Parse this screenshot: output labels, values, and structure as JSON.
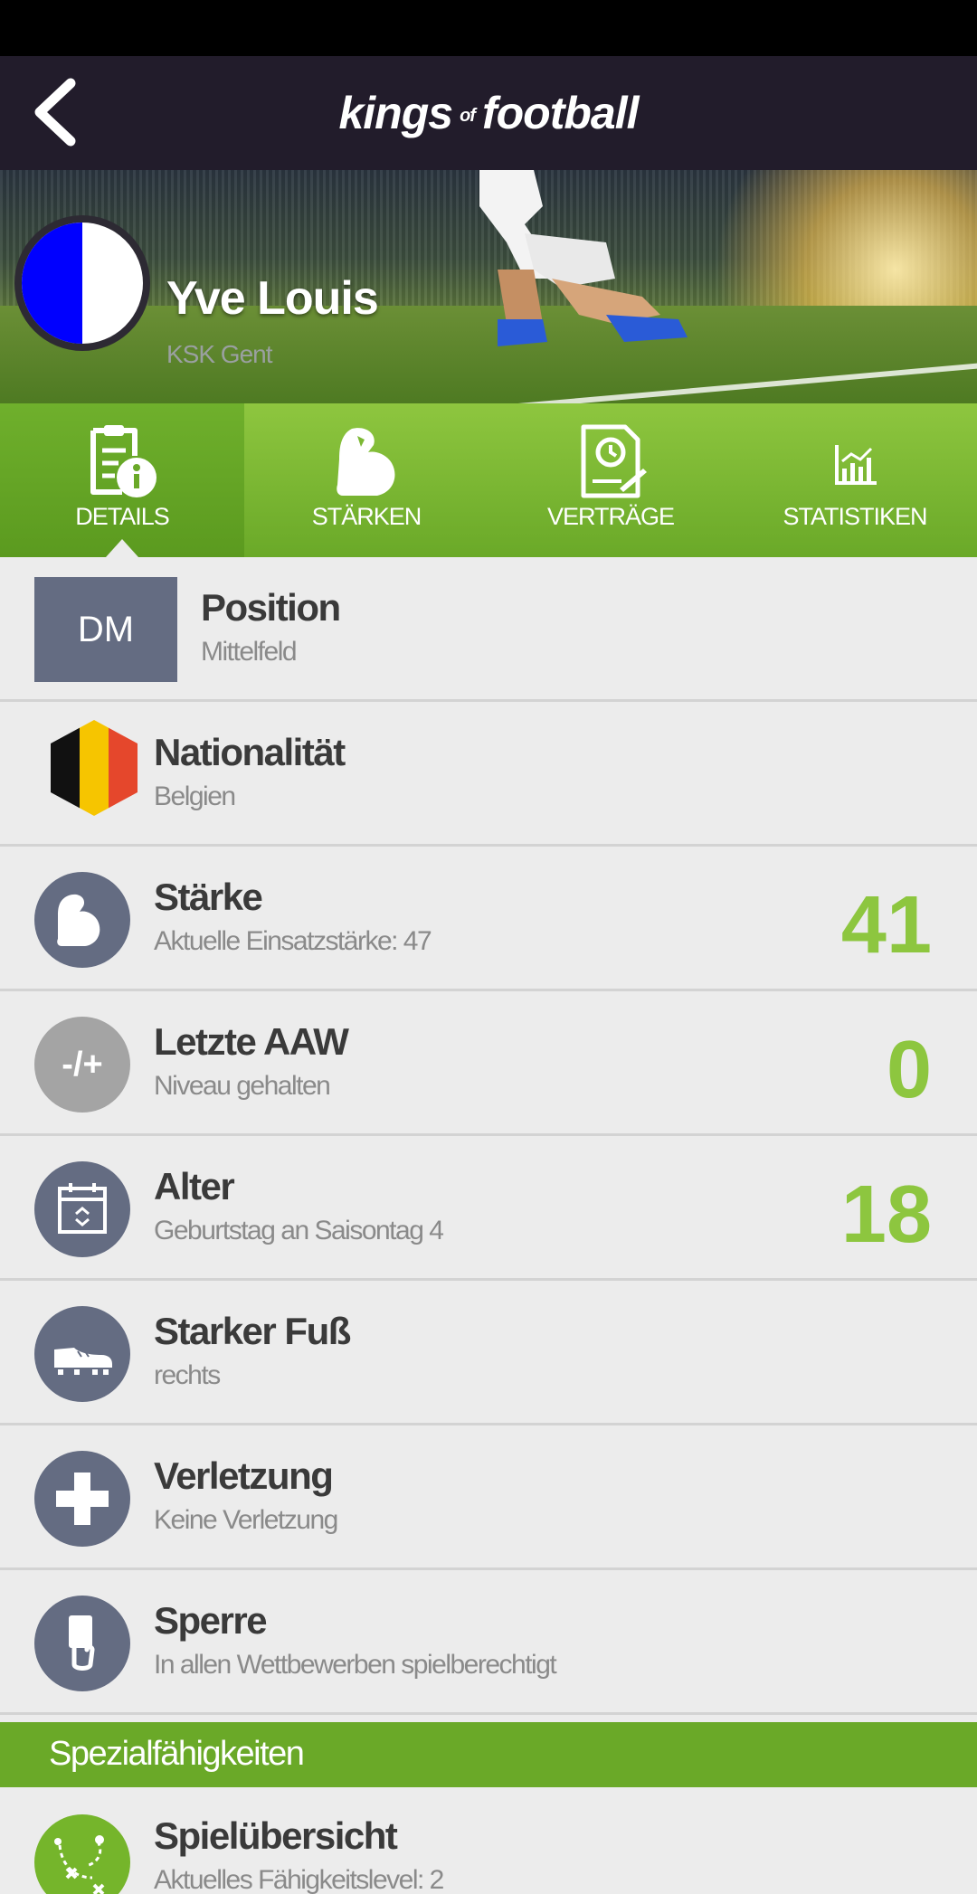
{
  "header": {
    "logo_kings": "kings",
    "logo_of": "of",
    "logo_football": "football"
  },
  "player": {
    "name": "Yve Louis",
    "club": "KSK Gent"
  },
  "tabs": [
    {
      "label": "DETAILS",
      "icon": "details-icon",
      "active": true
    },
    {
      "label": "STÄRKEN",
      "icon": "muscle-icon",
      "active": false
    },
    {
      "label": "VERTRÄGE",
      "icon": "contract-icon",
      "active": false
    },
    {
      "label": "STATISTIKEN",
      "icon": "stats-icon",
      "active": false
    }
  ],
  "rows": {
    "position": {
      "badge": "DM",
      "title": "Position",
      "sub": "Mittelfeld"
    },
    "nationality": {
      "title": "Nationalität",
      "sub": "Belgien"
    },
    "strength": {
      "title": "Stärke",
      "sub": "Aktuelle Einsatzstärke: 47",
      "value": "41"
    },
    "last_aaw": {
      "icon_text": "-/+",
      "title": "Letzte AAW",
      "sub": "Niveau gehalten",
      "value": "0"
    },
    "age": {
      "title": "Alter",
      "sub": "Geburtstag an Saisontag 4",
      "value": "18"
    },
    "foot": {
      "title": "Starker Fuß",
      "sub": "rechts"
    },
    "injury": {
      "title": "Verletzung",
      "sub": "Keine Verletzung"
    },
    "suspension": {
      "title": "Sperre",
      "sub": "In allen Wettbewerben spielberechtigt"
    }
  },
  "special_section": {
    "label": "Spezialfähigkeiten"
  },
  "skills": [
    {
      "title": "Spielübersicht",
      "sub": "Aktuelles Fähigkeitslevel: 2"
    }
  ],
  "colors": {
    "app_bar": "#221c2b",
    "accent_green": "#8dc63f",
    "icon_slate": "#646c82",
    "background": "#ececec",
    "club_blue": "#0000ff"
  }
}
